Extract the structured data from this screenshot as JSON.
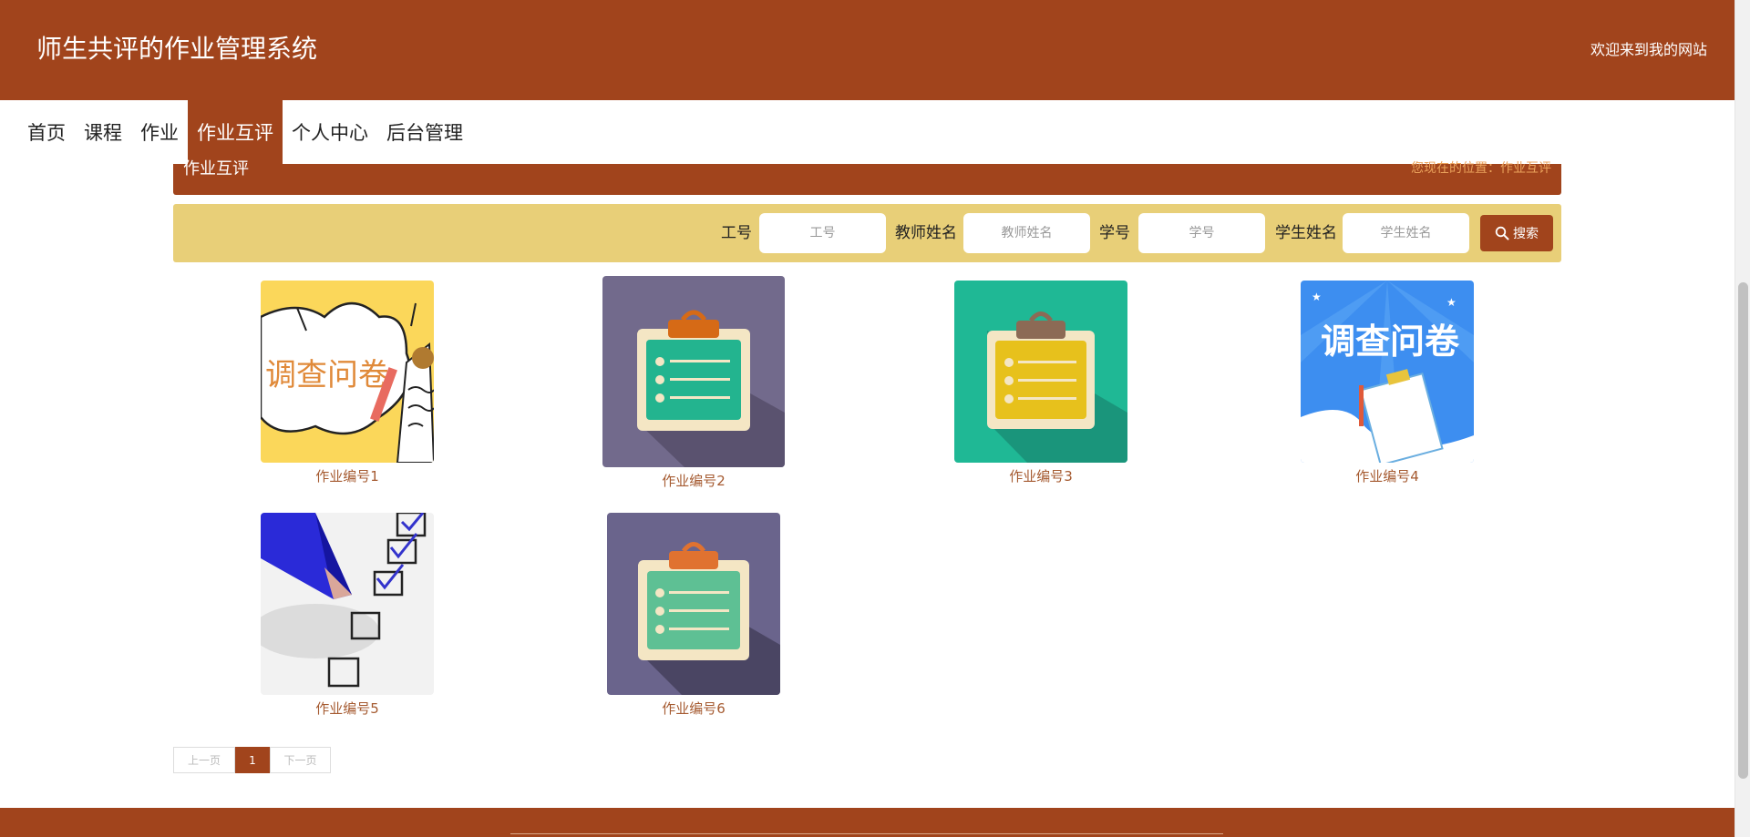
{
  "header": {
    "title": "师生共评的作业管理系统",
    "welcome": "欢迎来到我的网站"
  },
  "nav": {
    "items": [
      "首页",
      "课程",
      "作业",
      "作业互评",
      "个人中心",
      "后台管理"
    ],
    "active": "作业互评"
  },
  "breadcrumb": {
    "title": "作业互评",
    "position": "您现在的位置：作业互评"
  },
  "search": {
    "fields": [
      {
        "label": "工号",
        "placeholder": "工号"
      },
      {
        "label": "教师姓名",
        "placeholder": "教师姓名"
      },
      {
        "label": "学号",
        "placeholder": "学号"
      },
      {
        "label": "学生姓名",
        "placeholder": "学生姓名"
      }
    ],
    "button_label": "搜索"
  },
  "cards": [
    {
      "label": "作业编号1",
      "image": "survey-cartoon"
    },
    {
      "label": "作业编号2",
      "image": "clipboard-purple"
    },
    {
      "label": "作业编号3",
      "image": "clipboard-teal"
    },
    {
      "label": "作业编号4",
      "image": "survey-blue"
    },
    {
      "label": "作业编号5",
      "image": "checklist-pencil"
    },
    {
      "label": "作业编号6",
      "image": "clipboard-purple-green"
    }
  ],
  "pagination": {
    "prev": "上一页",
    "current": "1",
    "next": "下一页"
  },
  "colors": {
    "primary": "#a1441c",
    "search_bg": "#e8cf78",
    "card_label": "#a55a30"
  }
}
